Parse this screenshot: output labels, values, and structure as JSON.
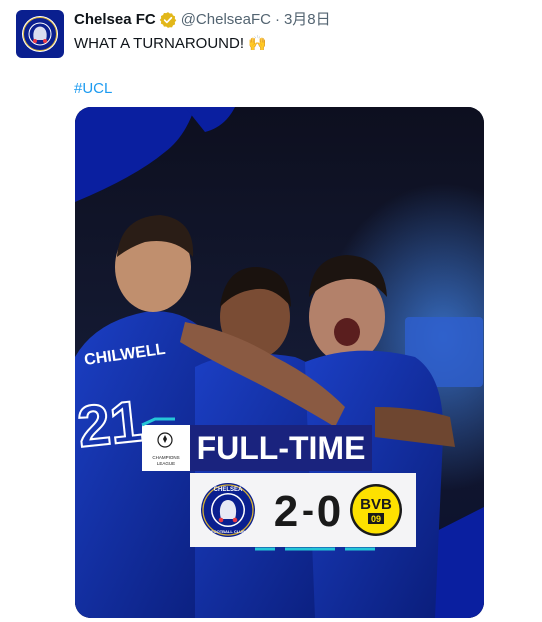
{
  "account": {
    "display_name": "Chelsea FC",
    "handle": "@ChelseaFC",
    "separator": "·",
    "timestamp": "3月8日",
    "verified_color": "#e2b719",
    "avatar_color": "#0a1f8f"
  },
  "tweet": {
    "text": "WHAT A TURNAROUND! 🙌",
    "hashtag": "#UCL"
  },
  "image": {
    "banner": "FULL-TIME",
    "home_score": "2",
    "dash": "-",
    "away_score": "0",
    "home_crest_text_top": "CHELSEA",
    "home_crest_text_bottom": "FOOTBALL CLUB",
    "away_crest_text_top": "BVB",
    "away_crest_text_bottom": "09",
    "ucl_label_line1": "CHAMPIONS",
    "ucl_label_line2": "LEAGUE",
    "player_name": "CHILWELL",
    "player_number": "21",
    "colors": {
      "chelsea_blue": "#0a1fa0",
      "banner_blue": "#1a237e",
      "bvb_yellow": "#fde100",
      "teal_accent": "#25c6d8"
    }
  }
}
